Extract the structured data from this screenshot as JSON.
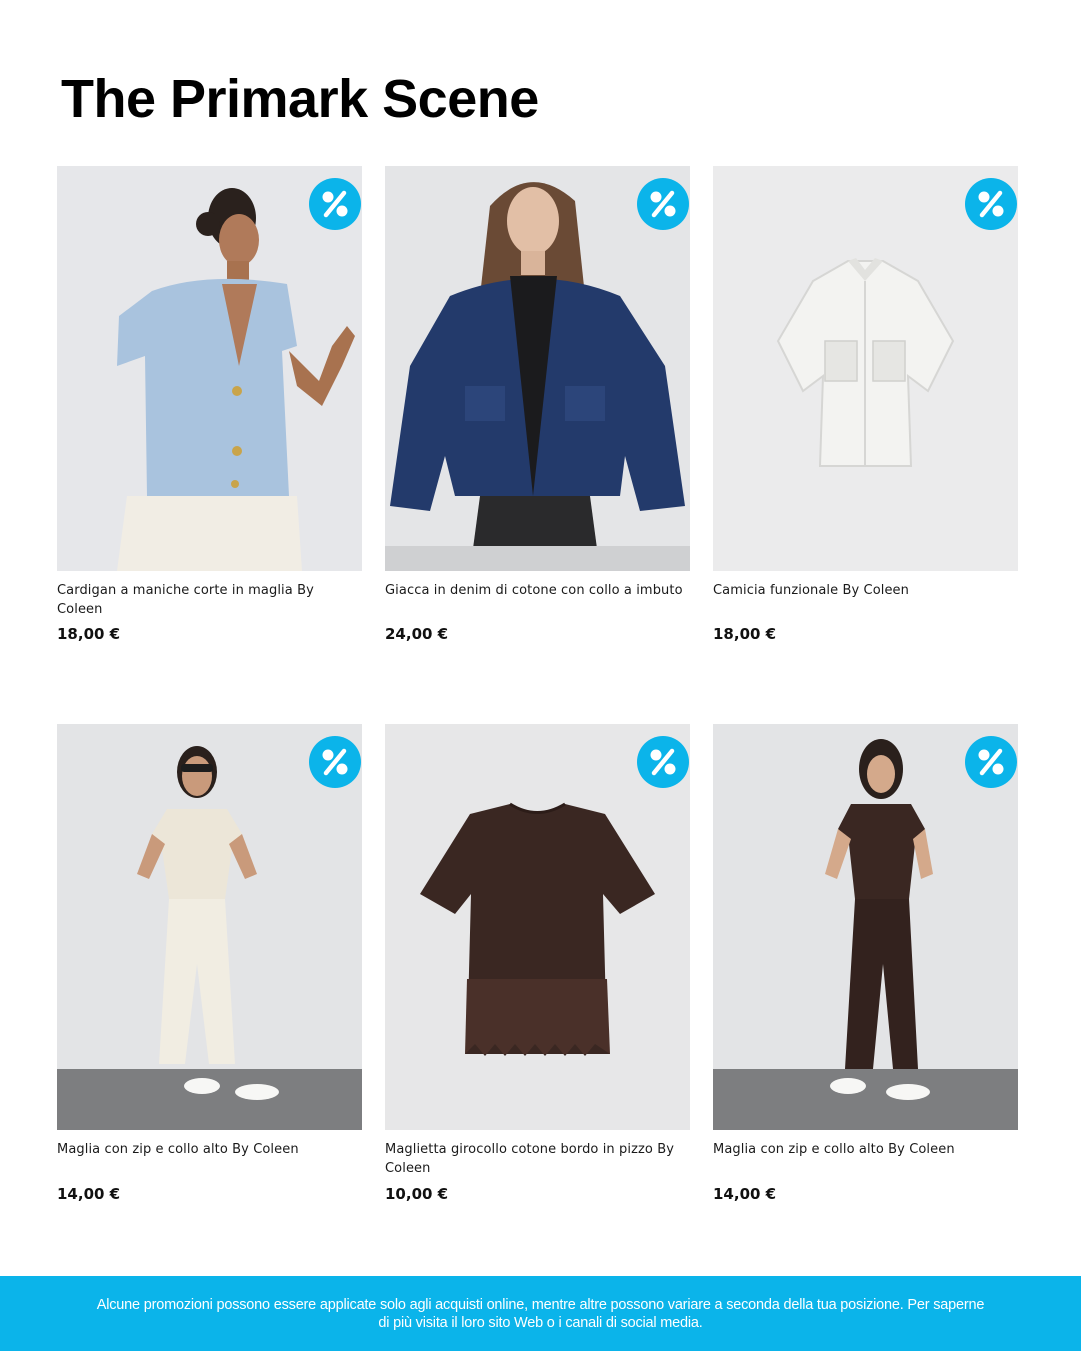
{
  "page": {
    "title": "The Primark Scene"
  },
  "colors": {
    "accent": "#0bb4ea",
    "photo_background": "#e9e9eb",
    "text": "#111111"
  },
  "badge": {
    "icon": "percent-icon"
  },
  "products": [
    {
      "name": "Cardigan a maniche corte in maglia By Coleen",
      "price": "18,00 €"
    },
    {
      "name": "Giacca in denim di cotone con collo a imbuto",
      "price": "24,00 €"
    },
    {
      "name": "Camicia funzionale By Coleen",
      "price": "18,00 €"
    },
    {
      "name": "Maglia con zip e collo alto By Coleen",
      "price": "14,00 €"
    },
    {
      "name": "Maglietta girocollo cotone bordo in pizzo By Coleen",
      "price": "10,00 €"
    },
    {
      "name": "Maglia con zip e collo alto By Coleen",
      "price": "14,00 €"
    }
  ],
  "footer": {
    "disclaimer": "Alcune promozioni possono essere applicate solo agli acquisti online, mentre altre possono variare a seconda della tua posizione. Per saperne di più visita il loro sito Web o i canali di social media."
  }
}
